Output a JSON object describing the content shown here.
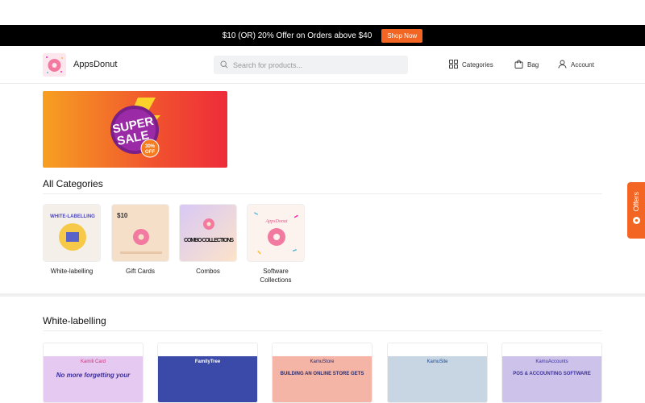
{
  "promo": {
    "text": "$10 (OR) 20% Offer on Orders above $40",
    "button_label": "Shop Now"
  },
  "header": {
    "brand": "AppsDonut",
    "search_placeholder": "Search for products...",
    "nav": {
      "categories": "Categories",
      "bag": "Bag",
      "account": "Account"
    }
  },
  "banner": {
    "line1": "SUPER",
    "line2": "SALE",
    "badge_pct": "30%",
    "badge_off": "OFF"
  },
  "all_categories": {
    "title": "All Categories",
    "items": [
      {
        "label": "White-labelling",
        "art_text": "WHITE-LABELLING"
      },
      {
        "label": "Gift Cards",
        "art_text": "$10"
      },
      {
        "label": "Combos",
        "art_text": "COMBO COLLECTIONS"
      },
      {
        "label": "Software Collections",
        "art_text": "AppsDonut"
      }
    ]
  },
  "offers_tab": {
    "label": "Offers"
  },
  "white_labelling": {
    "title": "White-labelling",
    "cards": [
      {
        "brand": "Kamili Card",
        "tagline": "No more forgetting your",
        "bg": "#e6c9f0"
      },
      {
        "brand": "FamilyTree",
        "tagline": "",
        "bg": "#3b4aa8"
      },
      {
        "brand": "KamuStore",
        "tagline": "BUILDING AN ONLINE STORE GETS",
        "bg": "#f5b5a6"
      },
      {
        "brand": "KamuSite",
        "tagline": "",
        "bg": "#c7d6e2"
      },
      {
        "brand": "KamuAccounts",
        "tagline": "POS & ACCOUNTING SOFTWARE",
        "bg": "#cdc3ea"
      }
    ]
  },
  "colors": {
    "accent": "#f26522",
    "promo_bg": "#000000"
  }
}
